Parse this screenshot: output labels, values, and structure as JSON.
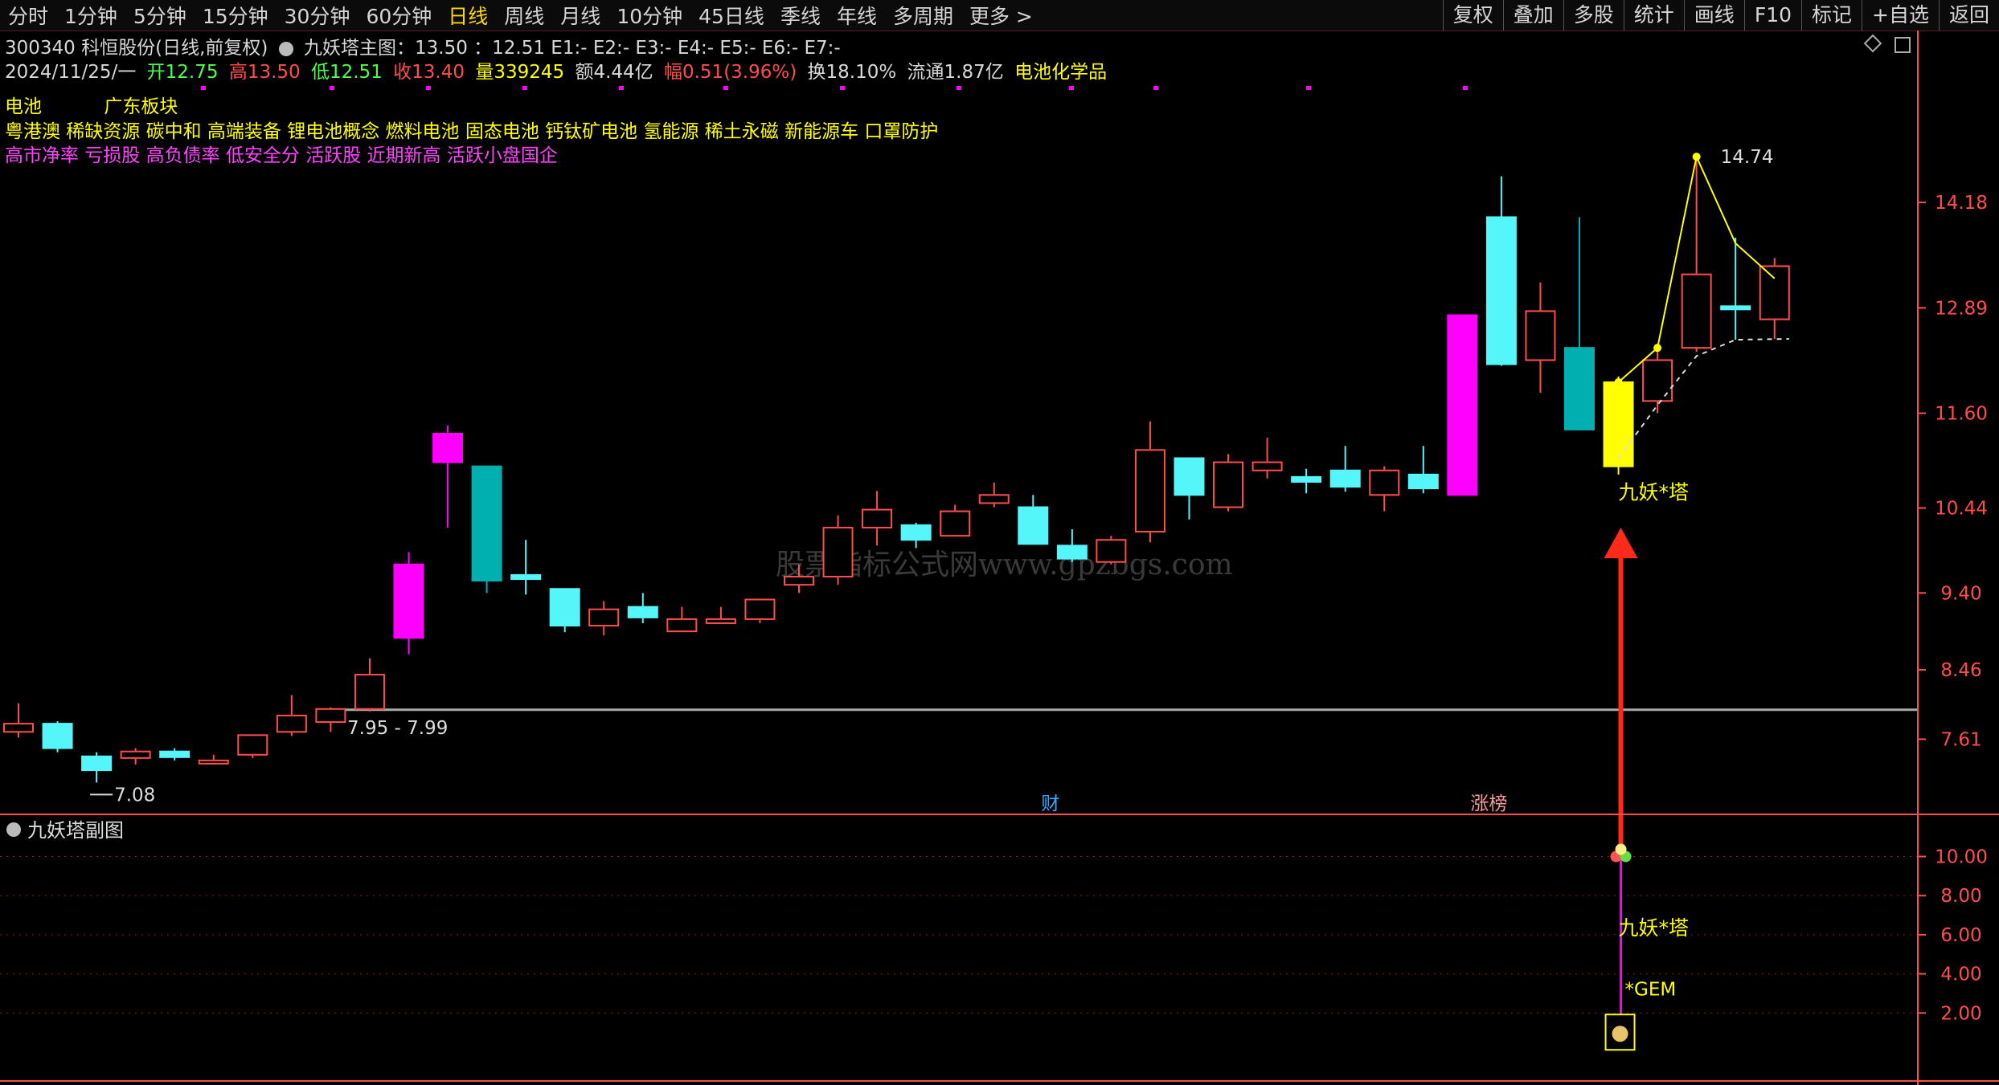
{
  "toolbar": {
    "periods": [
      "分时",
      "1分钟",
      "5分钟",
      "15分钟",
      "30分钟",
      "60分钟",
      "日线",
      "周线",
      "月线",
      "10分钟",
      "45日线",
      "季线",
      "年线",
      "多周期",
      "更多 >"
    ],
    "active_period": "日线",
    "right_buttons": [
      "复权",
      "叠加",
      "多股",
      "统计",
      "画线",
      "F10",
      "标记",
      "+自选",
      "返回"
    ]
  },
  "header": {
    "stock": "300340 科恒股份(日线,前复权)",
    "indicator_title": "九妖塔主图：13.50 ：12.51 E1:- E2:- E3:- E4:- E5:- E6:- E7:-",
    "date": "2024/11/25/一",
    "open": "开12.75",
    "high": "高13.50",
    "low": "低12.51",
    "close": "收13.40",
    "volume": "量339245",
    "amount": "额4.44亿",
    "change": "幅0.51(3.96%)",
    "turnover": "换18.10%",
    "float": "流通1.87亿",
    "industry": "电池化学品"
  },
  "tags": {
    "row1": [
      "电池",
      "广东板块"
    ],
    "row2": "粤港澳 稀缺资源 碳中和 高端装备 锂电池概念 燃料电池 固态电池 钙钛矿电池 氢能源 稀土永磁 新能源车 口罩防护",
    "row3": "高市净率 亏损股 高负债率 低安全分 活跃股 近期新高 活跃小盘国企"
  },
  "colors": {
    "up": "#ff4d4d",
    "down": "#54f6fa",
    "magenta": "#ff00ff",
    "teal": "#00b0b0",
    "yellow": "#ffff00",
    "grid": "#8b1a1a",
    "axis": "#ff4d4d"
  },
  "chart_data": {
    "type": "candlestick",
    "y_ticks": [
      7.61,
      8.46,
      9.4,
      10.44,
      11.6,
      12.89,
      14.18
    ],
    "ylim": [
      6.7,
      15.4
    ],
    "support_line": 7.97,
    "annotations": {
      "low_label": "7.08",
      "high_label": "14.74",
      "support_label": "7.95 - 7.99",
      "signal_label": "九妖*塔",
      "fin_marker": "财",
      "limit_marker": "涨榜",
      "watermark": "股票指标公式网www.gpzbgs.com"
    },
    "candles": [
      {
        "o": 7.7,
        "c": 7.8,
        "h": 8.05,
        "l": 7.63,
        "s": "up"
      },
      {
        "o": 7.8,
        "c": 7.5,
        "h": 7.83,
        "l": 7.45,
        "s": "down"
      },
      {
        "o": 7.4,
        "c": 7.23,
        "h": 7.45,
        "l": 7.08,
        "s": "down"
      },
      {
        "o": 7.38,
        "c": 7.46,
        "h": 7.5,
        "l": 7.3,
        "s": "up"
      },
      {
        "o": 7.46,
        "c": 7.39,
        "h": 7.5,
        "l": 7.35,
        "s": "down"
      },
      {
        "o": 7.32,
        "c": 7.35,
        "h": 7.42,
        "l": 7.3,
        "s": "up"
      },
      {
        "o": 7.42,
        "c": 7.66,
        "h": 7.66,
        "l": 7.38,
        "s": "up"
      },
      {
        "o": 7.7,
        "c": 7.9,
        "h": 8.15,
        "l": 7.65,
        "s": "up"
      },
      {
        "o": 7.82,
        "c": 7.98,
        "h": 8.0,
        "l": 7.7,
        "s": "up"
      },
      {
        "o": 7.98,
        "c": 8.4,
        "h": 8.6,
        "l": 7.95,
        "s": "up"
      },
      {
        "o": 8.85,
        "c": 9.75,
        "h": 9.9,
        "l": 8.65,
        "s": "magenta"
      },
      {
        "o": 11.0,
        "c": 11.35,
        "h": 11.45,
        "l": 10.2,
        "s": "magenta"
      },
      {
        "o": 10.95,
        "c": 9.55,
        "h": 9.95,
        "l": 9.4,
        "s": "teal"
      },
      {
        "o": 9.62,
        "c": 9.57,
        "h": 10.05,
        "l": 9.38,
        "s": "down"
      },
      {
        "o": 9.45,
        "c": 9.0,
        "h": 9.45,
        "l": 8.92,
        "s": "down"
      },
      {
        "o": 9.0,
        "c": 9.2,
        "h": 9.3,
        "l": 8.88,
        "s": "up"
      },
      {
        "o": 9.23,
        "c": 9.1,
        "h": 9.4,
        "l": 9.03,
        "s": "down"
      },
      {
        "o": 8.93,
        "c": 9.08,
        "h": 9.23,
        "l": 8.93,
        "s": "up"
      },
      {
        "o": 9.03,
        "c": 9.08,
        "h": 9.23,
        "l": 9.03,
        "s": "up"
      },
      {
        "o": 9.08,
        "c": 9.32,
        "h": 9.32,
        "l": 9.03,
        "s": "up"
      },
      {
        "o": 9.5,
        "c": 9.6,
        "h": 9.75,
        "l": 9.4,
        "s": "up"
      },
      {
        "o": 9.6,
        "c": 10.2,
        "h": 10.35,
        "l": 9.5,
        "s": "up"
      },
      {
        "o": 10.2,
        "c": 10.42,
        "h": 10.65,
        "l": 9.98,
        "s": "up"
      },
      {
        "o": 10.23,
        "c": 10.05,
        "h": 10.26,
        "l": 9.95,
        "s": "down"
      },
      {
        "o": 10.1,
        "c": 10.4,
        "h": 10.48,
        "l": 10.1,
        "s": "up"
      },
      {
        "o": 10.5,
        "c": 10.6,
        "h": 10.75,
        "l": 10.45,
        "s": "up"
      },
      {
        "o": 10.45,
        "c": 10.0,
        "h": 10.6,
        "l": 10.0,
        "s": "down"
      },
      {
        "o": 9.98,
        "c": 9.82,
        "h": 10.18,
        "l": 9.78,
        "s": "down"
      },
      {
        "o": 9.78,
        "c": 10.05,
        "h": 10.1,
        "l": 9.75,
        "s": "up"
      },
      {
        "o": 10.15,
        "c": 11.15,
        "h": 11.5,
        "l": 10.02,
        "s": "up"
      },
      {
        "o": 11.05,
        "c": 10.6,
        "h": 11.05,
        "l": 10.3,
        "s": "down"
      },
      {
        "o": 10.45,
        "c": 11.0,
        "h": 11.1,
        "l": 10.4,
        "s": "up"
      },
      {
        "o": 10.9,
        "c": 11.0,
        "h": 11.3,
        "l": 10.8,
        "s": "up"
      },
      {
        "o": 10.82,
        "c": 10.76,
        "h": 10.92,
        "l": 10.62,
        "s": "down"
      },
      {
        "o": 10.9,
        "c": 10.7,
        "h": 11.2,
        "l": 10.64,
        "s": "down"
      },
      {
        "o": 10.6,
        "c": 10.9,
        "h": 10.95,
        "l": 10.4,
        "s": "up"
      },
      {
        "o": 10.85,
        "c": 10.68,
        "h": 11.2,
        "l": 10.62,
        "s": "down"
      },
      {
        "o": 10.6,
        "c": 12.8,
        "h": 12.8,
        "l": 10.6,
        "s": "magenta"
      },
      {
        "o": 14.0,
        "c": 12.2,
        "h": 14.5,
        "l": 12.18,
        "s": "down"
      },
      {
        "o": 12.25,
        "c": 12.85,
        "h": 13.2,
        "l": 11.85,
        "s": "up"
      },
      {
        "o": 12.4,
        "c": 11.4,
        "h": 14.0,
        "l": 11.4,
        "s": "teal"
      },
      {
        "o": 10.95,
        "c": 11.98,
        "h": 12.05,
        "l": 10.85,
        "s": "yellow"
      },
      {
        "o": 11.75,
        "c": 12.25,
        "h": 12.4,
        "l": 11.6,
        "s": "up"
      },
      {
        "o": 12.4,
        "c": 13.3,
        "h": 14.74,
        "l": 12.35,
        "s": "up"
      },
      {
        "o": 12.91,
        "c": 12.89,
        "h": 13.75,
        "l": 12.5,
        "s": "down"
      },
      {
        "o": 12.75,
        "c": 13.4,
        "h": 13.5,
        "l": 12.51,
        "s": "up"
      }
    ],
    "sub_chart": {
      "title": "九妖塔副图",
      "y_ticks": [
        2.0,
        4.0,
        6.0,
        8.0,
        10.0
      ],
      "ylim": [
        0,
        11.5
      ],
      "signal_label": "九妖*塔",
      "gem_label": "*GEM"
    }
  }
}
